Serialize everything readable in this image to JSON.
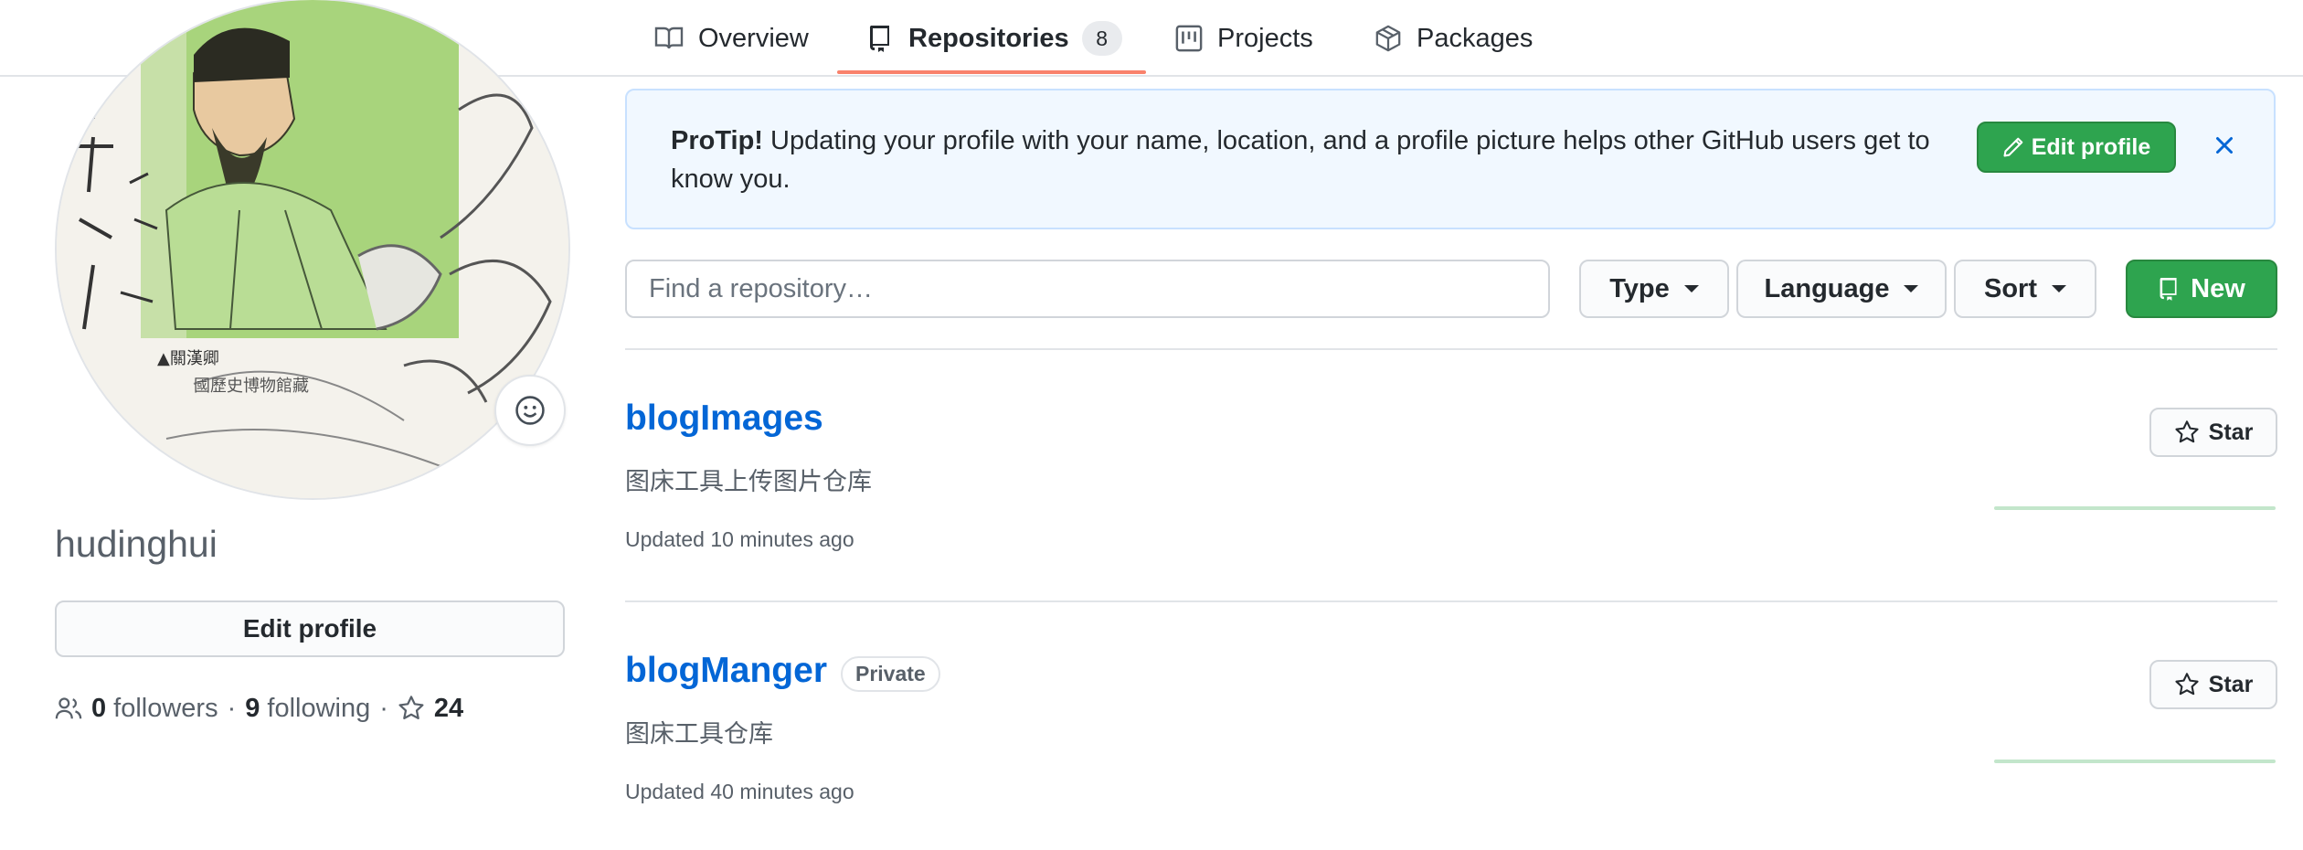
{
  "nav": {
    "tabs": [
      {
        "label": "Overview",
        "icon": "book-icon"
      },
      {
        "label": "Repositories",
        "icon": "repo-icon",
        "count": "8",
        "selected": true
      },
      {
        "label": "Projects",
        "icon": "project-icon"
      },
      {
        "label": "Packages",
        "icon": "package-icon"
      }
    ]
  },
  "profile": {
    "avatar_caption_1": "▲關漢卿",
    "avatar_caption_2": "國歷史博物館藏",
    "username": "hudinghui",
    "edit_profile_label": "Edit profile",
    "followers_count": "0",
    "followers_label": "followers",
    "following_count": "9",
    "following_label": "following",
    "stars_count": "24"
  },
  "protip": {
    "bold": "ProTip!",
    "text": " Updating your profile with your name, location, and a profile picture helps other GitHub users get to know you.",
    "button_label": "Edit profile"
  },
  "filters": {
    "search_placeholder": "Find a repository…",
    "type_label": "Type",
    "language_label": "Language",
    "sort_label": "Sort",
    "new_label": "New"
  },
  "repos": [
    {
      "name": "blogImages",
      "description": "图床工具上传图片仓库",
      "updated": "Updated 10 minutes ago",
      "star_label": "Star"
    },
    {
      "name": "blogManger",
      "badge": "Private",
      "description": "图床工具仓库",
      "updated": "Updated 40 minutes ago",
      "star_label": "Star"
    }
  ],
  "colors": {
    "link": "#0366d6",
    "primary_button": "#2ea44f",
    "tab_underline": "#f9826c",
    "protip_bg": "#f1f8ff"
  }
}
